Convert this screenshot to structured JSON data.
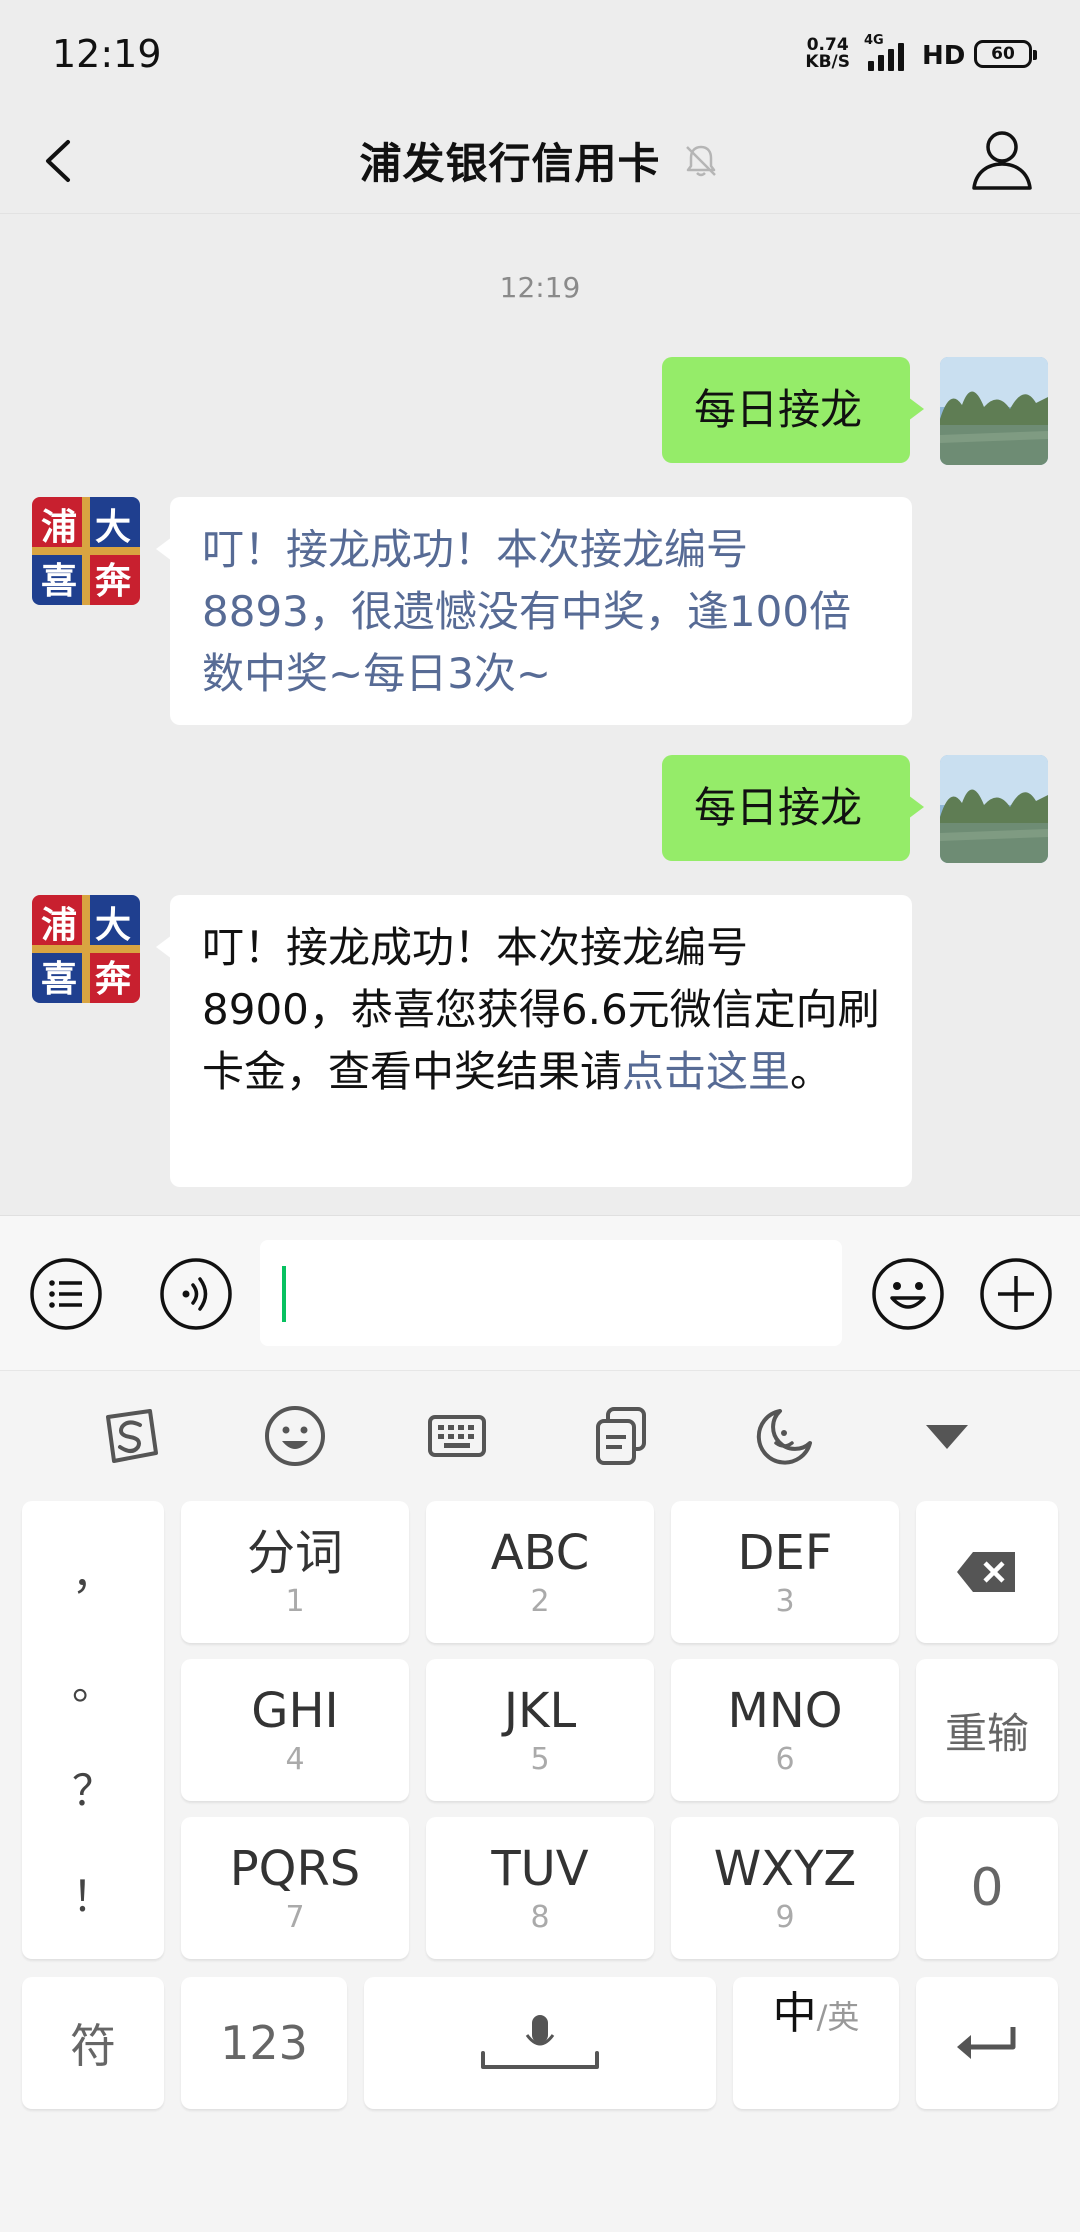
{
  "status_bar": {
    "time": "12:19",
    "net_speed_value": "0.74",
    "net_speed_unit": "KB/S",
    "network_type": "4G",
    "hd_label": "HD",
    "battery": "60"
  },
  "header": {
    "title": "浦发银行信用卡"
  },
  "chat": {
    "timestamp": "12:19",
    "messages": [
      {
        "direction": "out",
        "text": "每日接龙"
      },
      {
        "direction": "in",
        "text": "叮！接龙成功！本次接龙编号8893，很遗憾没有中奖，逢100倍数中奖~每日3次~"
      },
      {
        "direction": "out",
        "text": "每日接龙"
      },
      {
        "direction": "in",
        "text_before_link": "叮！接龙成功！本次接龙编号8900，恭喜您获得6.6元微信定向刷卡金，查看中奖结果请",
        "link_text": "点击这里",
        "text_after_link": "。"
      }
    ],
    "bot_avatar_text": [
      "浦",
      "大",
      "喜",
      "奔"
    ]
  },
  "keyboard": {
    "punctuation": [
      "，",
      "。",
      "？",
      "！"
    ],
    "rows": [
      [
        {
          "main": "分词",
          "sub": "1"
        },
        {
          "main": "ABC",
          "sub": "2"
        },
        {
          "main": "DEF",
          "sub": "3"
        }
      ],
      [
        {
          "main": "GHI",
          "sub": "4"
        },
        {
          "main": "JKL",
          "sub": "5"
        },
        {
          "main": "MNO",
          "sub": "6"
        }
      ],
      [
        {
          "main": "PQRS",
          "sub": "7"
        },
        {
          "main": "TUV",
          "sub": "8"
        },
        {
          "main": "WXYZ",
          "sub": "9"
        }
      ]
    ],
    "retype_label": "重输",
    "zero_label": "0",
    "symbol_label": "符",
    "numbers_label": "123",
    "lang_zh": "中",
    "lang_sep": "/",
    "lang_en": "英"
  },
  "colors": {
    "out_bubble": "#95ec69",
    "in_bubble": "#ffffff",
    "link": "#576b95",
    "caret": "#07c160",
    "bot_avatar_red": "#c8202f",
    "bot_avatar_blue": "#1f3f8f"
  }
}
